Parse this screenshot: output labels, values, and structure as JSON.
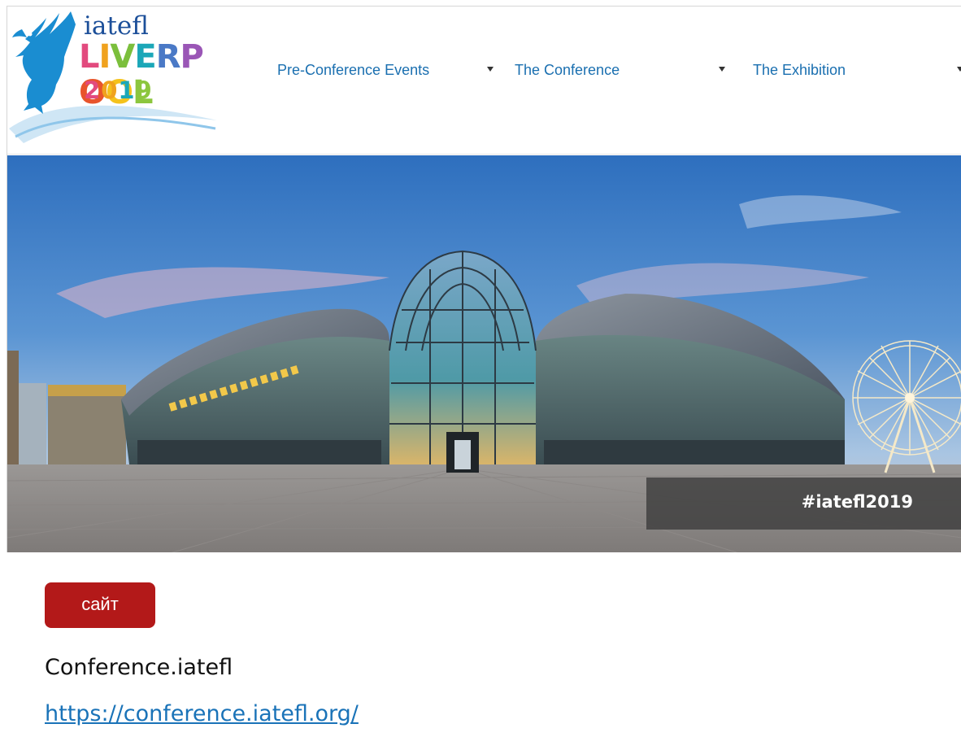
{
  "logo": {
    "top_text": "iatefl",
    "city_letters": [
      "L",
      "I",
      "V",
      "E",
      "R",
      "P",
      "O",
      "O",
      "L"
    ],
    "city_colors": [
      "#e24a7e",
      "#f0a21e",
      "#7bbf3c",
      "#1ba7b8",
      "#4a79c6",
      "#9a56b6",
      "#e8542c",
      "#f4c21c",
      "#8cc63e"
    ],
    "year_digits": [
      "2",
      "0",
      "1",
      "9"
    ],
    "year_colors": [
      "#e24a7e",
      "#f0a21e",
      "#1ba7b8",
      "#8cc63e"
    ],
    "bird_color": "#1a8dd1",
    "icon": "liver-bird-icon"
  },
  "nav": {
    "items": [
      {
        "label": "Pre-Conference Events"
      },
      {
        "label": "The Conference"
      },
      {
        "label": "The Exhibition"
      }
    ],
    "link_color": "#1a6fb0",
    "caret_icon": "caret-down-icon"
  },
  "banner": {
    "hashtag": "#iatefl2019"
  },
  "content": {
    "tag_label": "сайт",
    "tag_color": "#b31919",
    "site_name": "Conference.iatefl",
    "site_url": "https://conference.iatefl.org/"
  }
}
